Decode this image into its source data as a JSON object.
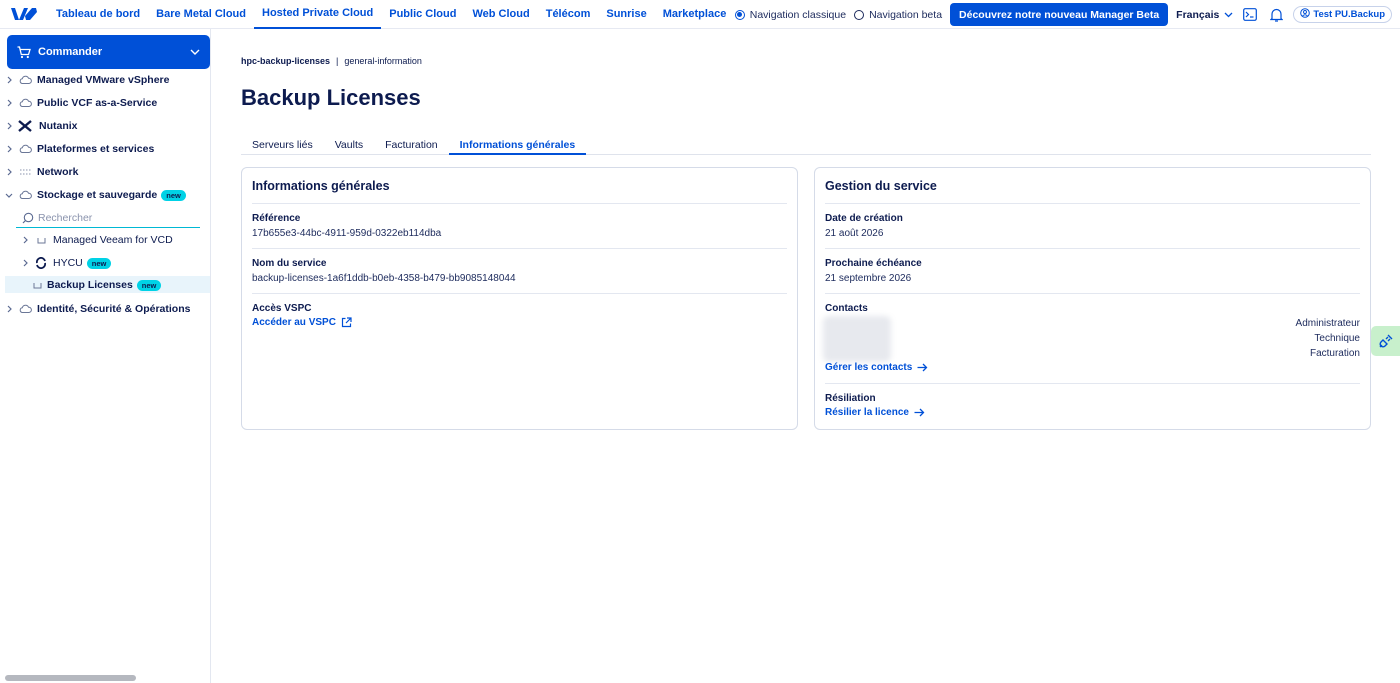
{
  "topnav": {
    "items": [
      {
        "label": "Tableau de bord",
        "active": false
      },
      {
        "label": "Bare Metal Cloud",
        "active": false
      },
      {
        "label": "Hosted Private Cloud",
        "active": true
      },
      {
        "label": "Public Cloud",
        "active": false
      },
      {
        "label": "Web Cloud",
        "active": false
      },
      {
        "label": "Télécom",
        "active": false
      },
      {
        "label": "Sunrise",
        "active": false
      },
      {
        "label": "Marketplace",
        "active": false
      }
    ],
    "nav_classic": "Navigation classique",
    "nav_beta": "Navigation beta",
    "beta_button": "Découvrez notre nouveau Manager Beta",
    "language": "Français",
    "account": "Test PU.Backup"
  },
  "sidebar": {
    "commander": "Commander",
    "items": [
      {
        "label": "Managed VMware vSphere",
        "icon": "cloud-icon"
      },
      {
        "label": "Public VCF as-a-Service",
        "icon": "cloud-icon"
      },
      {
        "label": "Nutanix",
        "icon": "nutanix-icon"
      },
      {
        "label": "Plateformes et services",
        "icon": "cloud-icon"
      },
      {
        "label": "Network",
        "icon": "network-icon"
      },
      {
        "label": "Stockage et sauvegarde",
        "icon": "storage-icon",
        "badge": "new"
      }
    ],
    "search_placeholder": "Rechercher",
    "subitems": [
      {
        "label": "Managed Veeam for VCD"
      },
      {
        "label": "HYCU",
        "badge": "new"
      },
      {
        "label": "Backup Licenses",
        "badge": "new",
        "active": true
      }
    ],
    "last_item": "Identité, Sécurité & Opérations"
  },
  "breadcrumb": {
    "first": "hpc-backup-licenses",
    "separator": "|",
    "second": "general-information"
  },
  "page_title": "Backup Licenses",
  "tabs": [
    {
      "label": "Serveurs liés",
      "active": false
    },
    {
      "label": "Vaults",
      "active": false
    },
    {
      "label": "Facturation",
      "active": false
    },
    {
      "label": "Informations générales",
      "active": true
    }
  ],
  "general_info": {
    "title": "Informations générales",
    "reference_label": "Référence",
    "reference_value": "17b655e3-44bc-4911-959d-0322eb114dba",
    "service_name_label": "Nom du service",
    "service_name_value": "backup-licenses-1a6f1ddb-b0eb-4358-b479-bb9085148044",
    "vspc_label": "Accès VSPC",
    "vspc_link": "Accéder au VSPC"
  },
  "service_mgmt": {
    "title": "Gestion du service",
    "creation_label": "Date de création",
    "creation_value": "21 août 2026",
    "expiry_label": "Prochaine échéance",
    "expiry_value": "21 septembre 2026",
    "contacts_label": "Contacts",
    "roles": [
      "Administrateur",
      "Technique",
      "Facturation"
    ],
    "manage_contacts": "Gérer les contacts",
    "termination_label": "Résiliation",
    "terminate_link": "Résilier la licence"
  },
  "colors": {
    "accent": "#0050d7",
    "navy": "#0d1b4f",
    "badge": "#00d2e6"
  }
}
